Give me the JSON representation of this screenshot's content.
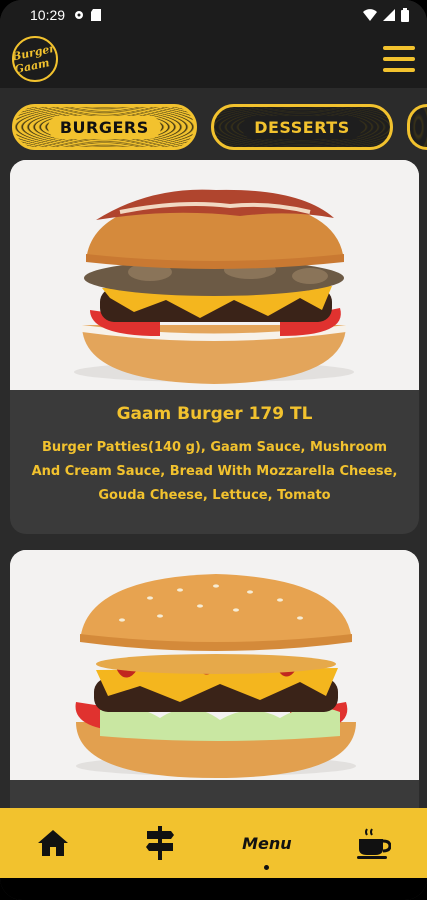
{
  "status": {
    "time": "10:29"
  },
  "app": {
    "logo_text": "Burger Gaam"
  },
  "tabs": [
    {
      "label": "BURGERS",
      "active": true
    },
    {
      "label": "DESSERTS",
      "active": false
    }
  ],
  "menu_items": [
    {
      "title": "Gaam Burger 179 TL",
      "description": "Burger Patties(140 g), Gaam Sauce, Mushroom And Cream Sauce, Bread With Mozzarella Cheese, Gouda Cheese, Lettuce, Tomato"
    },
    {
      "title": "",
      "description": ""
    }
  ],
  "bottom_nav": {
    "items": [
      {
        "icon": "home-icon"
      },
      {
        "icon": "signpost-icon"
      },
      {
        "label": "Menu",
        "active": true
      },
      {
        "icon": "coffee-cup-icon"
      }
    ]
  },
  "colors": {
    "accent": "#f2c22e",
    "background": "#2b2b2b",
    "card": "#3a3a3a"
  }
}
